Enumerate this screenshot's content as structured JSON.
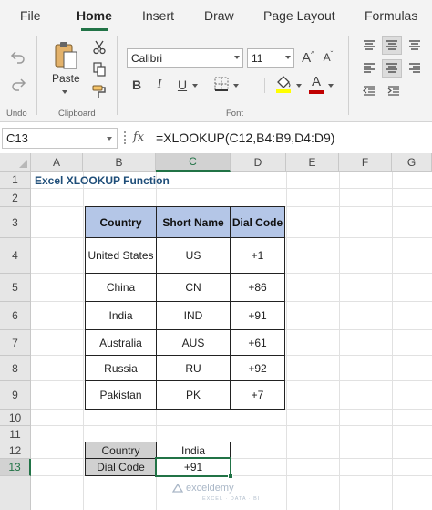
{
  "tabs": [
    "File",
    "Home",
    "Insert",
    "Draw",
    "Page Layout",
    "Formulas"
  ],
  "ribbon": {
    "undo_label": "Undo",
    "clipboard_label": "Clipboard",
    "paste_label": "Paste",
    "font_label": "Font",
    "font_name": "Calibri",
    "font_size": "11",
    "bold": "B",
    "italic": "I",
    "underline": "U",
    "font_color_letter": "A",
    "grow_font": "A",
    "shrink_font": "A",
    "font_color_hex": "#c00000",
    "highlight_color_hex": "#ffff00"
  },
  "formula_bar": {
    "name_box": "C13",
    "fx": "fx",
    "formula": "=XLOOKUP(C12,B4:B9,D4:D9)"
  },
  "sheet": {
    "columns": [
      "A",
      "B",
      "C",
      "D",
      "E",
      "F",
      "G"
    ],
    "rows": [
      "1",
      "2",
      "3",
      "4",
      "5",
      "6",
      "7",
      "8",
      "9",
      "10",
      "11",
      "12",
      "13"
    ],
    "title": "Excel XLOOKUP Function",
    "table": {
      "headers": [
        "Country",
        "Short Name",
        "Dial Code"
      ],
      "rows": [
        [
          "United States",
          "US",
          "+1"
        ],
        [
          "China",
          "CN",
          "+86"
        ],
        [
          "India",
          "IND",
          "+91"
        ],
        [
          "Australia",
          "AUS",
          "+61"
        ],
        [
          "Russia",
          "RU",
          "+92"
        ],
        [
          "Pakistan",
          "PK",
          "+7"
        ]
      ]
    },
    "lookup": {
      "country_label": "Country",
      "country_value": "India",
      "dial_label": "Dial Code",
      "dial_value": "+91"
    },
    "watermark": "exceldemy",
    "watermark_sub": "EXCEL · DATA · BI"
  },
  "colors": {
    "accent": "#217346",
    "header_fill": "#b4c6e7",
    "label_fill": "#d0d0d0"
  }
}
